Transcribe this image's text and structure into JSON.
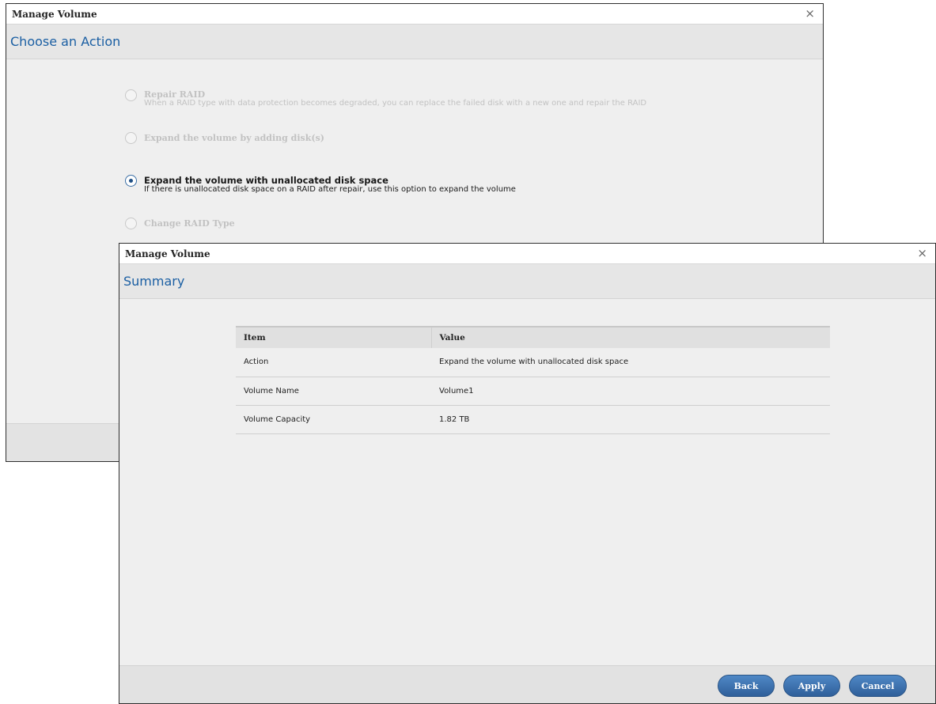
{
  "back_dialog": {
    "title": "Manage Volume",
    "close_glyph": "×",
    "section_title": "Choose an Action",
    "options": [
      {
        "label": "Repair RAID",
        "description": "When a RAID type with data protection becomes degraded, you can replace the failed disk with a new one and repair the RAID",
        "state": "disabled"
      },
      {
        "label": "Expand the volume by adding disk(s)",
        "description": "",
        "state": "disabled"
      },
      {
        "label": "Expand the volume with unallocated disk space",
        "description": "If there is unallocated disk space on a RAID after repair, use this option to expand the volume",
        "state": "selected"
      },
      {
        "label": "Change RAID Type",
        "description": "",
        "state": "disabled"
      }
    ]
  },
  "front_dialog": {
    "title": "Manage Volume",
    "close_glyph": "×",
    "section_title": "Summary",
    "table": {
      "headers": [
        "Item",
        "Value"
      ],
      "rows": [
        [
          "Action",
          "Expand the volume with unallocated disk space"
        ],
        [
          "Volume Name",
          "Volume1"
        ],
        [
          "Volume Capacity",
          "1.82 TB"
        ]
      ]
    },
    "buttons": {
      "back": "Back",
      "apply": "Apply",
      "cancel": "Cancel"
    }
  },
  "colors": {
    "title_blue": "#1b5fa3",
    "button_blue": "#3a6ea8",
    "dialog_bg": "#efefef"
  }
}
